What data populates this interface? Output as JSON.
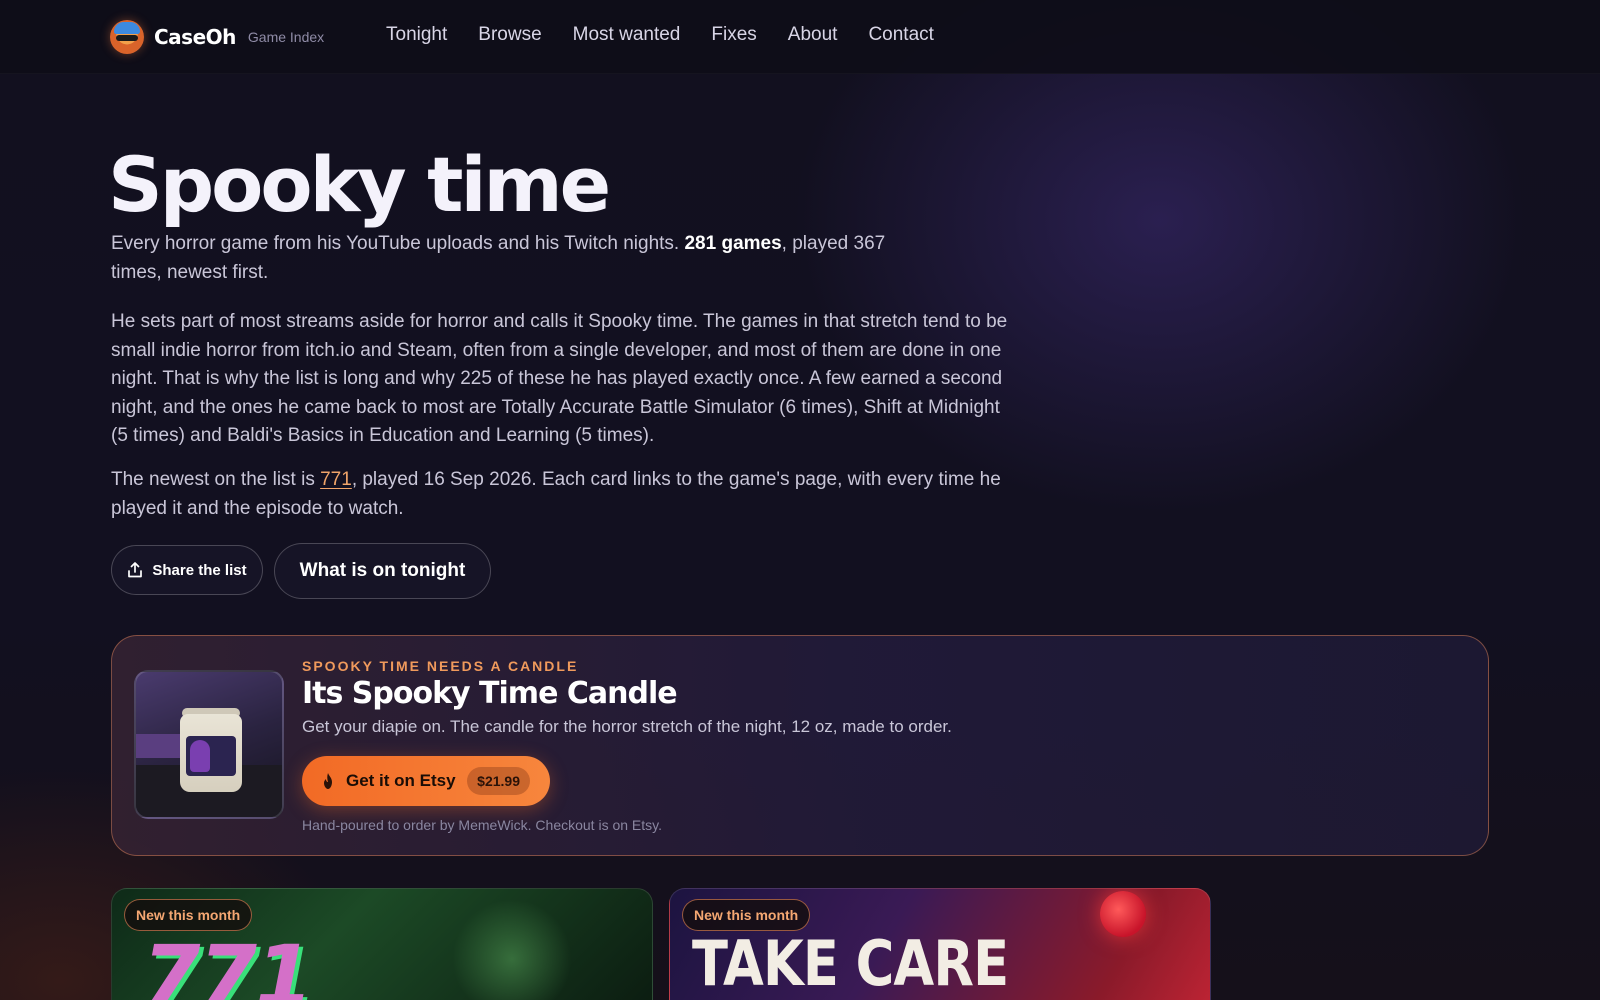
{
  "nav": {
    "brand": "CaseOh",
    "brand_sub": "Game Index",
    "links": [
      "Tonight",
      "Browse",
      "Most wanted",
      "Fixes",
      "About",
      "Contact"
    ]
  },
  "hero": {
    "title": "Spooky time",
    "intro_pre": "Every horror game from his YouTube uploads and his Twitch nights. ",
    "intro_bold": "281 games",
    "intro_post": ", played 367 times, newest first.",
    "body": "He sets part of most streams aside for horror and calls it Spooky time. The games in that stretch tend to be small indie horror from itch.io and Steam, often from a single developer, and most of them are done in one night. That is why the list is long and why 225 of these he has played exactly once. A few earned a second night, and the ones he came back to most are Totally Accurate Battle Simulator (6 times), Shift at Midnight (5 times) and Baldi's Basics in Education and Learning (5 times).",
    "newest_pre": "The newest on the list is ",
    "newest_link": "771",
    "newest_post": ", played 16 Sep 2026. Each card links to the game's page, with every time he played it and the episode to watch.",
    "share_label": "Share the list",
    "tonight_label": "What is on tonight"
  },
  "promo": {
    "kicker": "SPOOKY TIME NEEDS A CANDLE",
    "title": "Its Spooky Time Candle",
    "description": "Get your diapie on. The candle for the horror stretch of the night, 12 oz, made to order.",
    "cta_label": "Get it on Etsy",
    "price": "$21.99",
    "note": "Hand-poured to order by MemeWick. Checkout is on Etsy."
  },
  "cards": [
    {
      "badge": "New this month",
      "art_text": "771"
    },
    {
      "badge": "New this month",
      "art_text": "TAKE CARE"
    }
  ],
  "colors": {
    "accent": "#f26a25",
    "kicker": "#f09a5c",
    "background": "#0f0d1c"
  },
  "icons": [
    "share-icon",
    "flame-icon"
  ]
}
